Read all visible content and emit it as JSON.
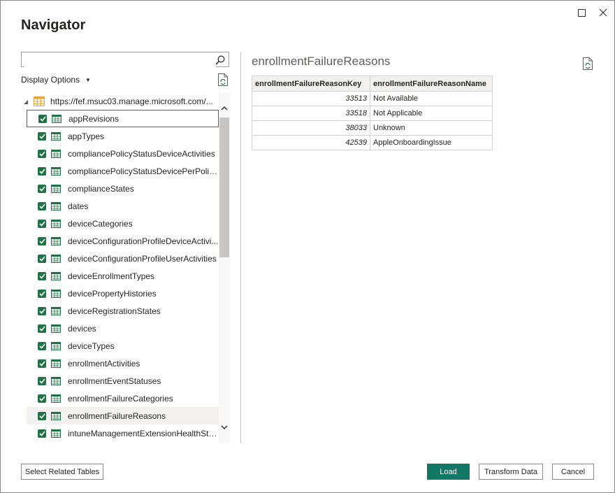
{
  "dialog": {
    "title": "Navigator"
  },
  "search": {
    "placeholder": "",
    "value": ""
  },
  "display_options_label": "Display Options",
  "tree": {
    "root_label": "https://fef.msuc03.manage.microsoft.com/...",
    "items": [
      {
        "label": "appRevisions",
        "checked": true
      },
      {
        "label": "appTypes",
        "checked": true
      },
      {
        "label": "compliancePolicyStatusDeviceActivities",
        "checked": true
      },
      {
        "label": "compliancePolicyStatusDevicePerPolic...",
        "checked": true
      },
      {
        "label": "complianceStates",
        "checked": true
      },
      {
        "label": "dates",
        "checked": true
      },
      {
        "label": "deviceCategories",
        "checked": true
      },
      {
        "label": "deviceConfigurationProfileDeviceActivi...",
        "checked": true
      },
      {
        "label": "deviceConfigurationProfileUserActivities",
        "checked": true
      },
      {
        "label": "deviceEnrollmentTypes",
        "checked": true
      },
      {
        "label": "devicePropertyHistories",
        "checked": true
      },
      {
        "label": "deviceRegistrationStates",
        "checked": true
      },
      {
        "label": "devices",
        "checked": true
      },
      {
        "label": "deviceTypes",
        "checked": true
      },
      {
        "label": "enrollmentActivities",
        "checked": true
      },
      {
        "label": "enrollmentEventStatuses",
        "checked": true
      },
      {
        "label": "enrollmentFailureCategories",
        "checked": true
      },
      {
        "label": "enrollmentFailureReasons",
        "checked": true
      },
      {
        "label": "intuneManagementExtensionHealthSta...",
        "checked": true
      }
    ]
  },
  "preview": {
    "title": "enrollmentFailureReasons",
    "columns": [
      "enrollmentFailureReasonKey",
      "enrollmentFailureReasonName"
    ],
    "rows": [
      [
        "33513",
        "Not Available"
      ],
      [
        "33518",
        "Not Applicable"
      ],
      [
        "38033",
        "Unknown"
      ],
      [
        "42539",
        "AppleOnboardingIssue"
      ]
    ]
  },
  "buttons": {
    "select_related": "Select Related Tables",
    "load": "Load",
    "transform": "Transform Data",
    "cancel": "Cancel"
  },
  "colors": {
    "accent": "#117865",
    "checkbox": "#217346",
    "table_icon": "#217346",
    "db_icon": "#e8a33d"
  }
}
